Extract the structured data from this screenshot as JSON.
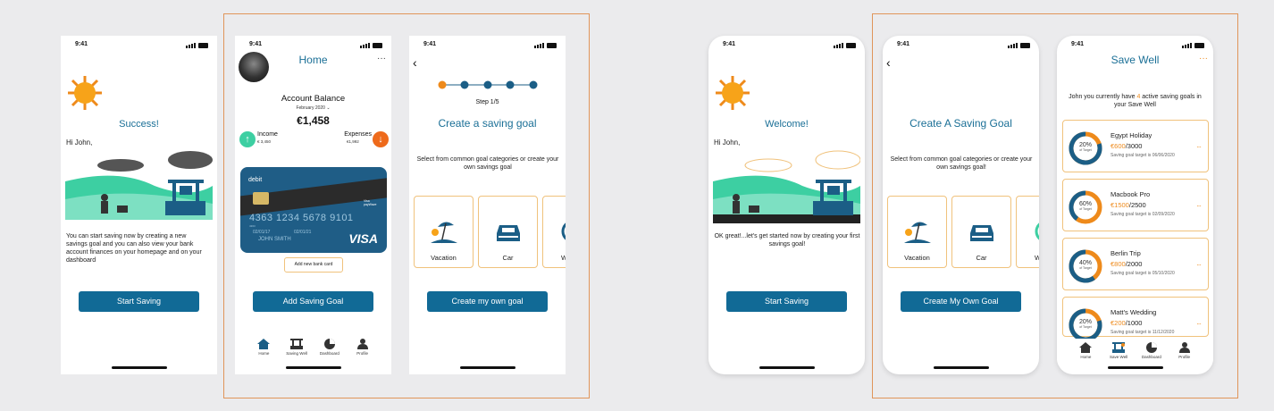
{
  "status_time": "9:41",
  "screen_success": {
    "title": "Success!",
    "greeting": "Hi John,",
    "body": "You can start saving now by creating a new savings goal and you can also view your bank account finances on your homepage and on your dashboard",
    "button": "Start Saving"
  },
  "screen_home": {
    "title": "Home",
    "menu": "···",
    "balance_label": "Account Balance",
    "month": "February 2020",
    "balance": "€1,458",
    "income_label": "Income",
    "income_value": "€ 3,450",
    "expenses_label": "Expenses",
    "expenses_value": "€1,992",
    "card": {
      "type": "debit",
      "number": "4363  1234  5678  9101",
      "sub": "4363",
      "valid_from": "02/01/17",
      "valid_thru": "02/01/21",
      "holder": "JOHN SMITH",
      "brand": "VISA",
      "paywave": "Visa payWave"
    },
    "add_card": "Add new bank card",
    "button": "Add Saving Goal",
    "tabs": [
      "Home",
      "Saving Well",
      "Dashboard",
      "Profile"
    ]
  },
  "screen_step": {
    "step": "Step 1/5",
    "title": "Create a saving goal",
    "body": "Select from common goal categories or create your own savings goal",
    "categories": [
      "Vacation",
      "Car",
      "W"
    ],
    "button": "Create my own goal"
  },
  "screen_welcome": {
    "title": "Welcome!",
    "greeting": "Hi John,",
    "body": "OK great!...let's get started now by creating your first savings goal!",
    "button": "Start Saving"
  },
  "screen_create": {
    "title": "Create A Saving Goal",
    "body": "Select from common goal categories or create your own savings goal!",
    "categories": [
      "Vacation",
      "Car",
      "W"
    ],
    "button": "Create My Own Goal"
  },
  "screen_savewell": {
    "title": "Save Well",
    "menu": "···",
    "intro_a": "John you currently have ",
    "intro_count": "4",
    "intro_b": " active saving goals in your Save Well",
    "goals": [
      {
        "name": "Egypt Holiday",
        "saved": "€600",
        "target": "/3000",
        "pct": "20%",
        "pct_value": 0.2,
        "sub": "of Target",
        "date": "Saving goal target is 06/06/2020"
      },
      {
        "name": "Macbook Pro",
        "saved": "€1500",
        "target": "/2500",
        "pct": "60%",
        "pct_value": 0.6,
        "sub": "of Target",
        "date": "Saving goal target is 02/09/2020"
      },
      {
        "name": "Berlin Trip",
        "saved": "€800",
        "target": "/2000",
        "pct": "40%",
        "pct_value": 0.4,
        "sub": "of Target",
        "date": "Saving goal target is 05/10/2020"
      },
      {
        "name": "Matt's Wedding",
        "saved": "€200",
        "target": "/1000",
        "pct": "20%",
        "pct_value": 0.2,
        "sub": "of Target",
        "date": "Saving goal target is 11/12/2020"
      }
    ],
    "tabs": [
      "Home",
      "Save Well",
      "Dashboard",
      "Profile"
    ]
  },
  "colors": {
    "primary": "#116a96",
    "accent": "#ee8a1b",
    "card": "#1f5d86",
    "frame": "#e0955a"
  }
}
